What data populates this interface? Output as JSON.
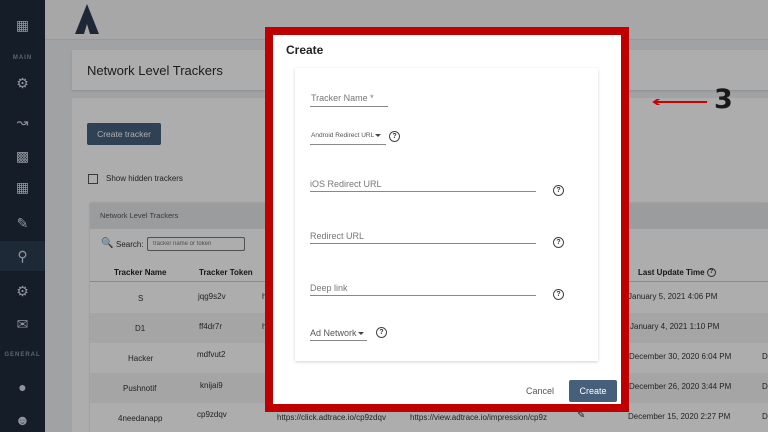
{
  "sidebar": {
    "sections": [
      "MAIN",
      "GENERAL"
    ],
    "icons": [
      "apps-grid-icon",
      "tracker-icon",
      "analytics-icon",
      "reports-icon",
      "grid-icon",
      "edit-icon",
      "search-user-icon",
      "settings-icon",
      "chat-icon",
      "github-icon",
      "team-icon"
    ]
  },
  "page": {
    "title": "Network Level Trackers",
    "create_tracker_label": "Create tracker",
    "show_hidden_label": "Show hidden trackers"
  },
  "table": {
    "card_title": "Network Level Trackers",
    "search_label": "Search:",
    "search_placeholder": "tracker name or token",
    "headers": [
      "Tracker Name",
      "Tracker Token",
      "Last Update Time"
    ],
    "rows": [
      {
        "name": "S",
        "token": "jqg9s2v",
        "c3": "h",
        "date": "January 5, 2021 4:06 PM"
      },
      {
        "name": "D1",
        "token": "ff4dr7r",
        "c3": "h",
        "date": "January 4, 2021 1:10 PM"
      },
      {
        "name": "Hacker",
        "token": "mdfvut2",
        "c3": "",
        "date": "December 30, 2020 6:04 PM",
        "extra": "D"
      },
      {
        "name": "Pushnotif",
        "token": "knijai9",
        "c3": "",
        "date": "December 26, 2020 3:44 PM",
        "extra": "D"
      },
      {
        "name": "4needanapp",
        "token": "cp9zdqv",
        "c3": "https://click.adtrace.io/cp9zdqv",
        "c4": "https://view.adtrace.io/impression/cp9z",
        "date": "December 15, 2020 2:27 PM",
        "extra": "D"
      }
    ]
  },
  "modal": {
    "title": "Create",
    "tracker_name_label": "Tracker Name *",
    "android_redirect_label": "Android Redirect URL",
    "ios_redirect_label": "iOS Redirect URL",
    "redirect_label": "Redirect URL",
    "deep_link_label": "Deep link",
    "ad_network_label": "Ad Network",
    "help_glyph": "?",
    "cancel_label": "Cancel",
    "create_label": "Create"
  },
  "annotation": {
    "number": "3",
    "color": "#c00000"
  }
}
